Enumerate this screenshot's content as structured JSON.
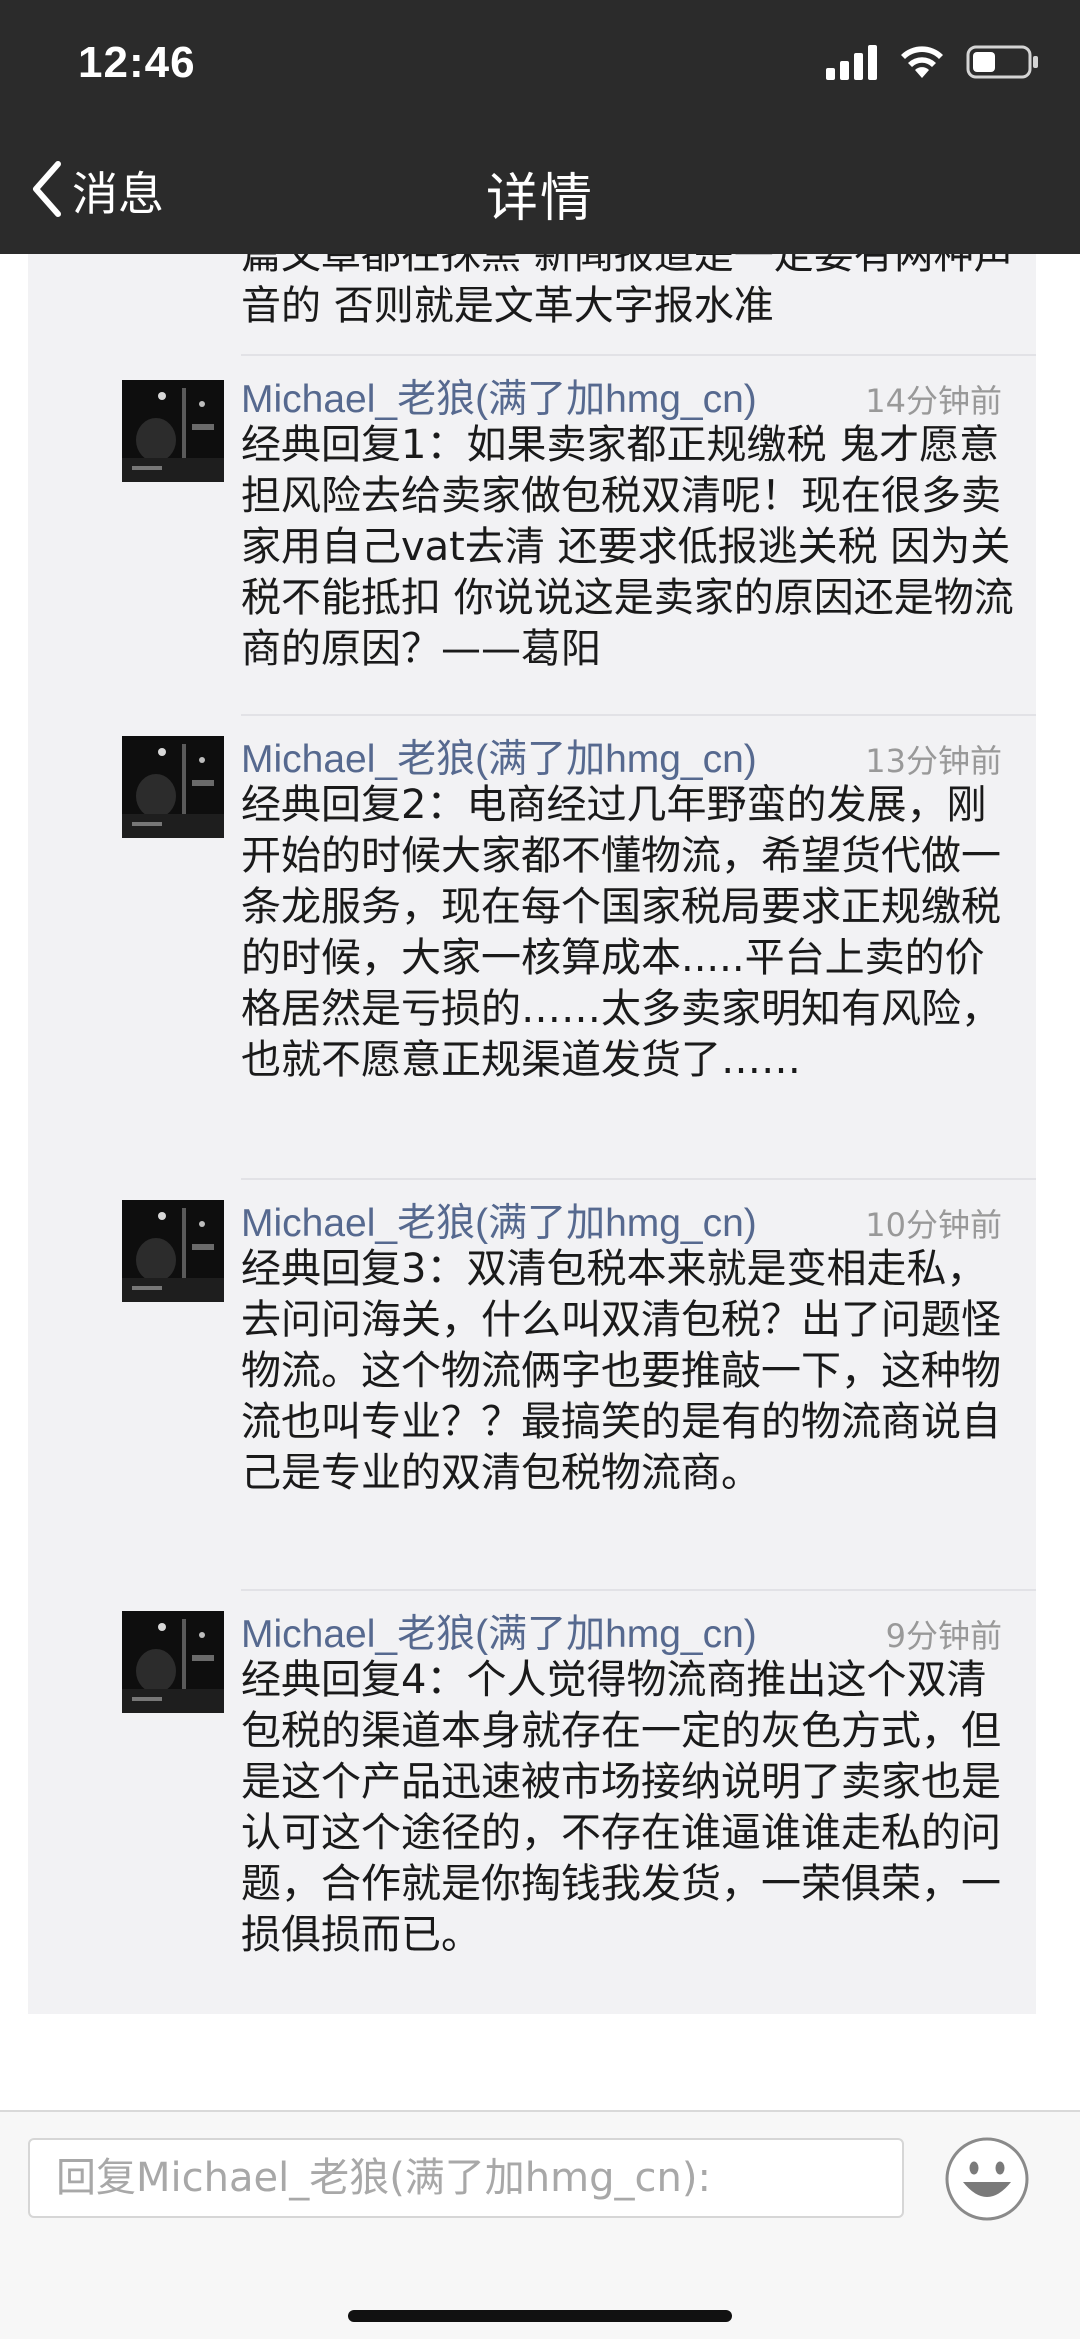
{
  "status_bar": {
    "time": "12:46"
  },
  "nav": {
    "back_label": "消息",
    "title": "详情"
  },
  "previous_text": "篇文章都在抹黑 新闻报道是一定要有两种声音的 否则就是文革大字报水准",
  "comments": [
    {
      "author": "Michael_老狼(满了加hmg_cn)",
      "time": "14分钟前",
      "text": "经典回复1：如果卖家都正规缴税 鬼才愿意担风险去给卖家做包税双清呢！现在很多卖家用自己vat去清 还要求低报逃关税 因为关税不能抵扣 你说说这是卖家的原因还是物流商的原因？——葛阳"
    },
    {
      "author": "Michael_老狼(满了加hmg_cn)",
      "time": "13分钟前",
      "text": "经典回复2：电商经过几年野蛮的发展，刚开始的时候大家都不懂物流，希望货代做一条龙服务，现在每个国家税局要求正规缴税的时候，大家一核算成本.....平台上卖的价格居然是亏损的……太多卖家明知有风险，也就不愿意正规渠道发货了……"
    },
    {
      "author": "Michael_老狼(满了加hmg_cn)",
      "time": "10分钟前",
      "text": "经典回复3：双清包税本来就是变相走私，去问问海关，什么叫双清包税？出了问题怪物流。这个物流俩字也要推敲一下，这种物流也叫专业？？最搞笑的是有的物流商说自己是专业的双清包税物流商。"
    },
    {
      "author": "Michael_老狼(满了加hmg_cn)",
      "time": "9分钟前",
      "text": "经典回复4：个人觉得物流商推出这个双清包税的渠道本身就存在一定的灰色方式，但是这个产品迅速被市场接纳说明了卖家也是认可这个途径的，不存在谁逼谁谁走私的问题，合作就是你掏钱我发货，一荣俱荣，一损俱损而已。"
    }
  ],
  "reply": {
    "placeholder": "回复Michael_老狼(满了加hmg_cn):"
  },
  "icons": {
    "back": "chevron-left-icon",
    "signal": "signal-icon",
    "wifi": "wifi-icon",
    "battery": "battery-icon",
    "emoji": "smiley-icon"
  },
  "colors": {
    "nav_background": "#2b2b2b",
    "author_name": "#56698f",
    "timestamp": "#999999",
    "panel_background": "#f2f2f4"
  }
}
